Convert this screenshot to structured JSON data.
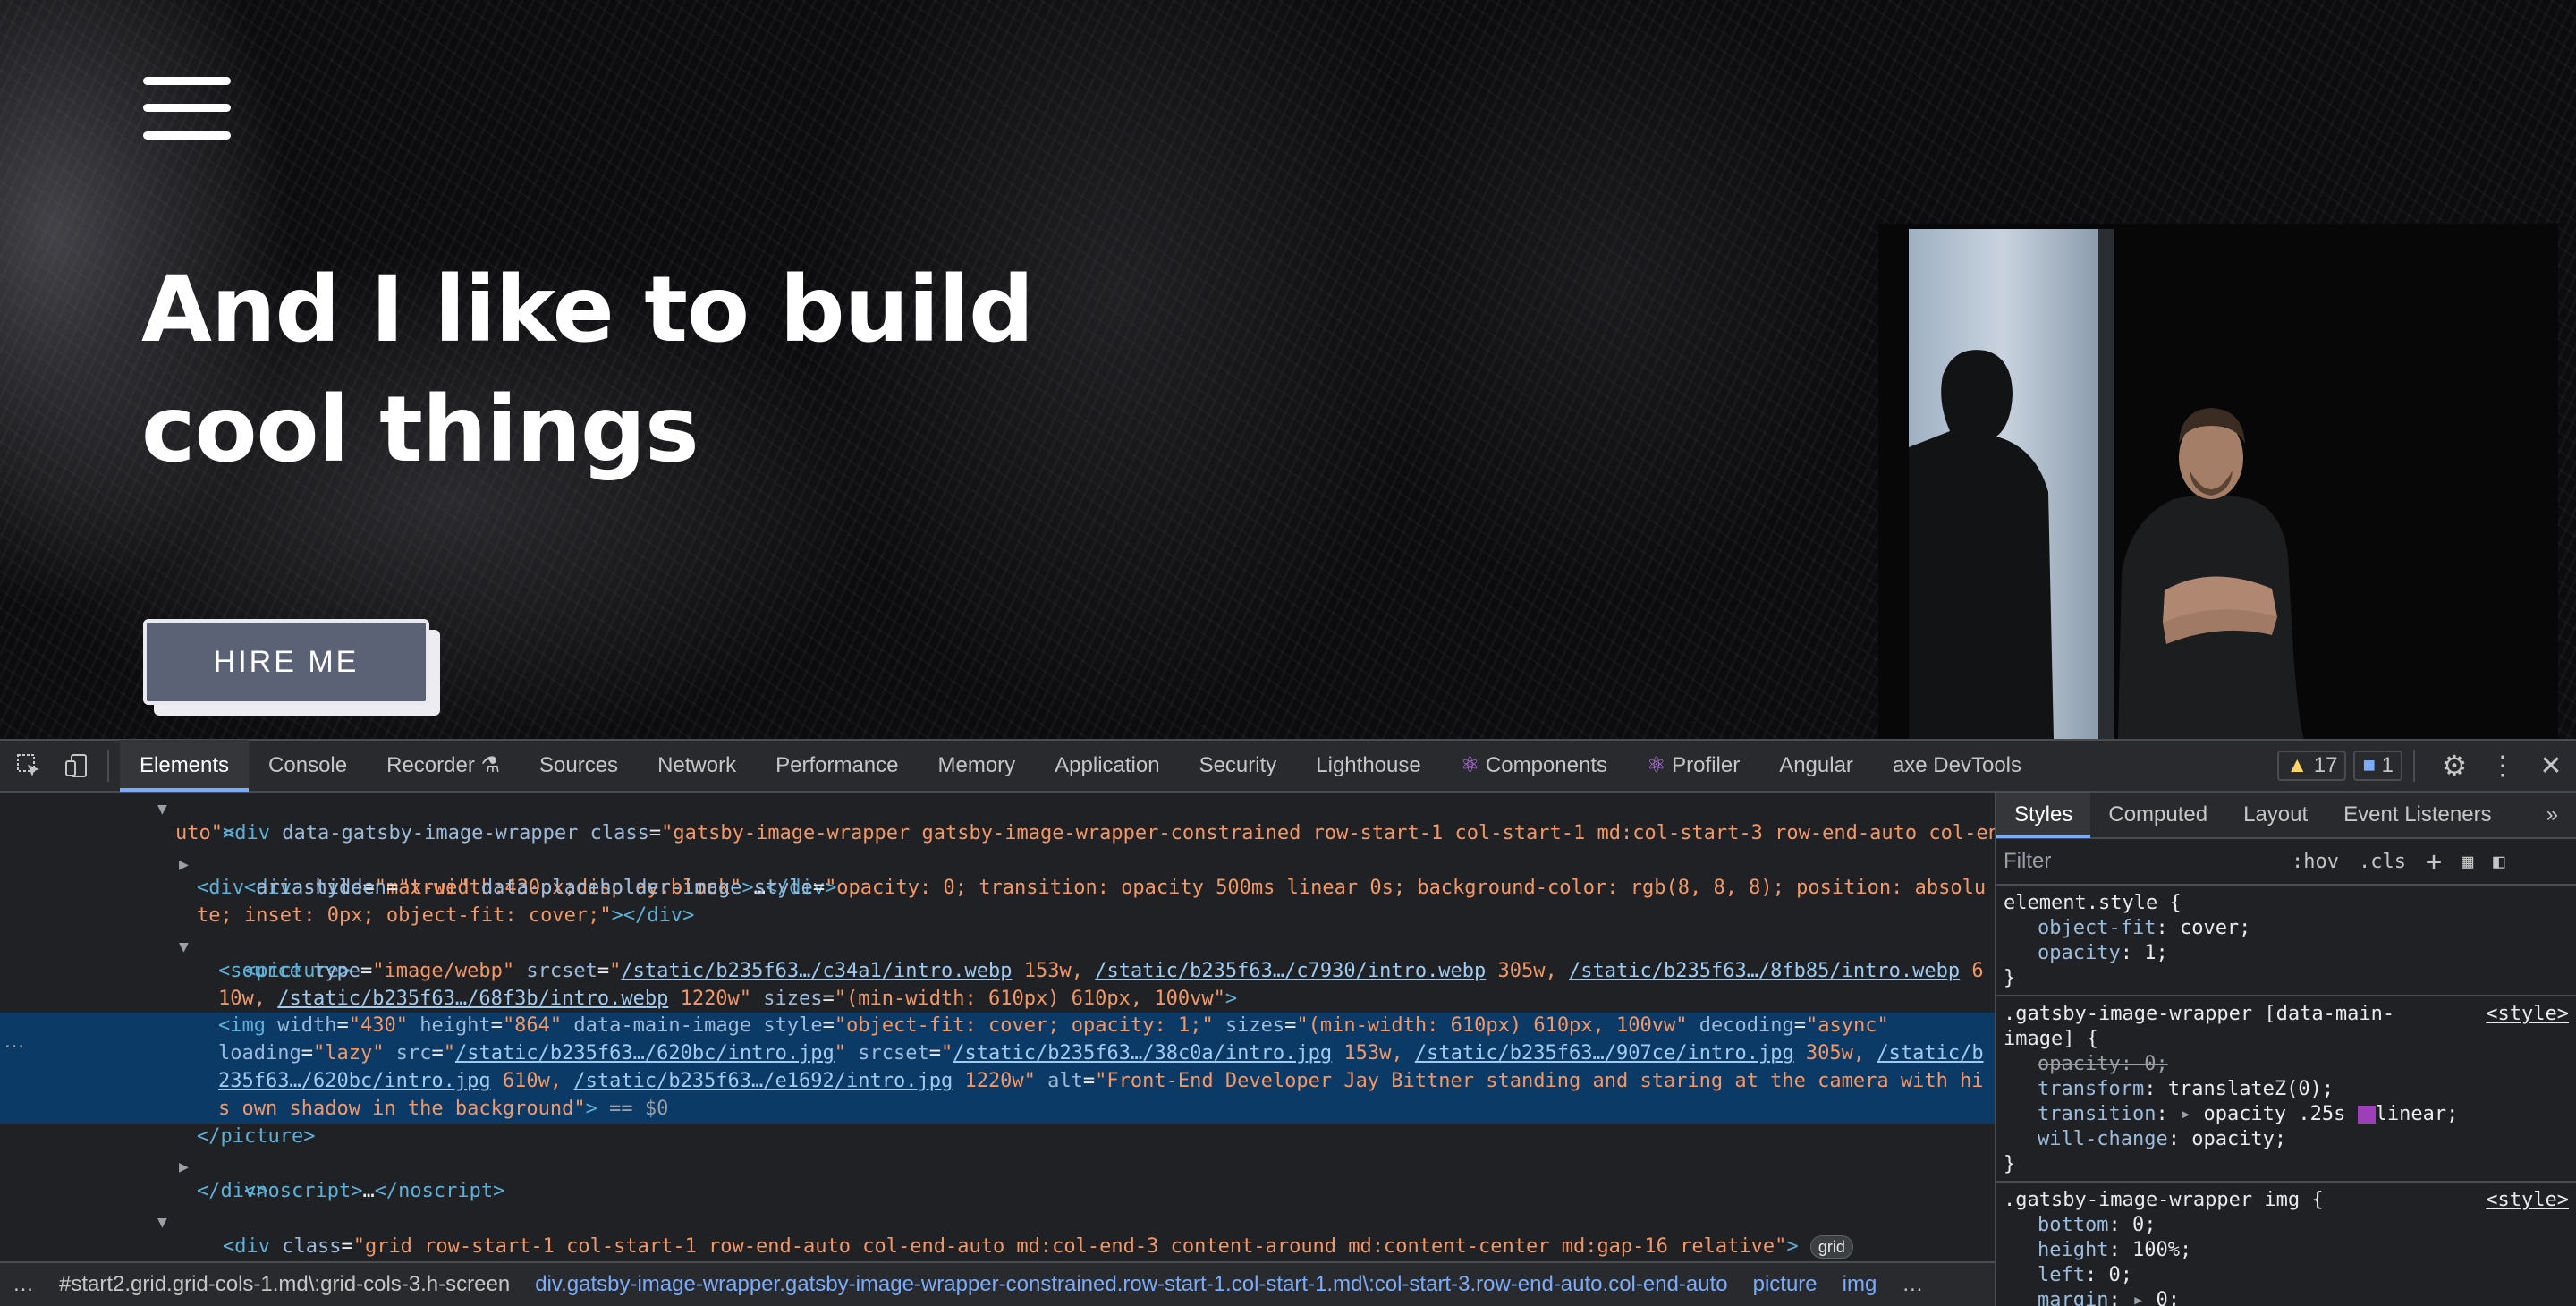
{
  "hero": {
    "title_line1": "And I like to build",
    "title_line2": "cool things",
    "hire_button": "HIRE ME",
    "menu_icon": "hamburger-menu-icon",
    "photo_alt": "Front-End Developer Jay Bittner standing and staring at the camera with his own shadow in the background"
  },
  "devtools": {
    "tabs": [
      "Elements",
      "Console",
      "Recorder",
      "Sources",
      "Network",
      "Performance",
      "Memory",
      "Application",
      "Security",
      "Lighthouse",
      "Components",
      "Profiler",
      "Angular",
      "axe DevTools"
    ],
    "active_tab": "Elements",
    "warnings_count": "17",
    "messages_count": "1",
    "icons": {
      "inspect": "inspect-element-icon",
      "device": "device-toolbar-icon",
      "settings": "gear-icon",
      "more": "kebab-menu-icon",
      "close": "close-icon"
    },
    "dom_lines": {
      "l1a": "div",
      "l1_attr1": "data-gatsby-image-wrapper",
      "l1_attr2": "class",
      "l1_val": "\"gatsby-image-wrapper gatsby-image-wrapper-constrained row-start-1 col-start-1 md:col-start-3 row-end-auto col-end-a",
      "l1_val2": "uto\"",
      "l2_style": "\"max-width:430px;display:block\"",
      "l3_style": "\"opacity: 0; transition: opacity 500ms linear 0s; background-color: rgb(8, 8, 8); position: absolu",
      "l3_style2": "te; inset: 0px; object-fit: cover;\"",
      "src1": "/static/b235f63…/c34a1/intro.webp",
      "src2": "/static/b235f63…/c7930/intro.webp",
      "src3": "/static/b235f63…/8fb85/intro.webp",
      "src4": "/static/b235f63…/68f3b/intro.webp",
      "sizes": "\"(min-width: 610px) 610px, 100vw\"",
      "img_style": "\"object-fit: cover; opacity: 1;\"",
      "img_src": "/static/b235f63…/620bc/intro.jpg",
      "img_s1": "/static/b235f63…/38c0a/intro.jpg",
      "img_s2": "/static/b235f63…/907ce/intro.jpg",
      "img_s3a": "/static/b",
      "img_s3b": "235f63…/620bc/intro.jpg",
      "img_s4": "/static/b235f63…/e1692/intro.jpg",
      "alt1": "\"Front-End Developer Jay Bittner standing and staring at the camera with hi",
      "alt2": "s own shadow in the background\"",
      "last_class": "\"grid row-start-1 col-start-1 row-end-auto col-end-auto md:col-end-3 content-around md:content-center md:gap-16 relative\"",
      "grid_badge": "grid"
    },
    "breadcrumbs": [
      "#start2.grid.grid-cols-1.md\\:grid-cols-3.h-screen",
      "div.gatsby-image-wrapper.gatsby-image-wrapper-constrained.row-start-1.col-start-1.md\\:col-start-3.row-end-auto.col-end-auto",
      "picture",
      "img"
    ],
    "styles_tabs": [
      "Styles",
      "Computed",
      "Layout",
      "Event Listeners"
    ],
    "filter_placeholder": "Filter",
    "filter_tools": [
      ":hov",
      ".cls"
    ],
    "rules": {
      "r1_selector": "element.style {",
      "r2_selector": ".gatsby-image-wrapper [data-main-",
      "r2_selector2": "image] {",
      "r3_selector": ".gatsby-image-wrapper img {",
      "source": "<style>"
    }
  }
}
